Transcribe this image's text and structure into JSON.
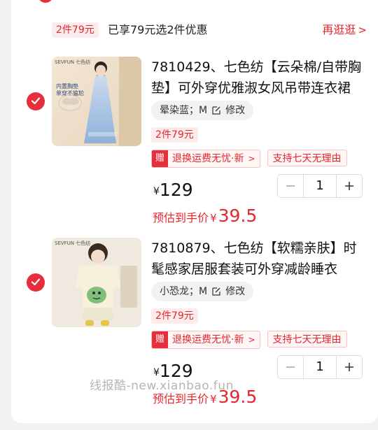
{
  "promo": {
    "tag": "2件79元",
    "text": "已享79元选2件优惠",
    "more": "再逛逛"
  },
  "items": [
    {
      "brand": "SEVFUN 七色纺",
      "thumb_caption": "内置胸垫\n单穿不尴尬",
      "title": "7810429、七色纺【云朵棉/自带胸垫】可外穿优雅淑女风吊带连衣裙",
      "spec": "晕染蓝；M",
      "edit": "修改",
      "deal": "2件79元",
      "gift_mark": "赠",
      "gift_text": "退换运费无忧·新",
      "badge2": "支持七天无理由",
      "currency": "¥",
      "price": "129",
      "quantity": "1",
      "est_label": "预估到手价",
      "est_price": "39.5"
    },
    {
      "brand": "SEVFUN 七色纺",
      "title": "7810879、七色纺【软糯亲肤】时髦感家居服套装可外穿减龄睡衣",
      "spec": "小恐龙；M",
      "edit": "修改",
      "deal": "2件79元",
      "gift_mark": "赠",
      "gift_text": "退换运费无忧·新",
      "badge2": "支持七天无理由",
      "currency": "¥",
      "price": "129",
      "quantity": "1",
      "est_label": "预估到手价",
      "est_price": "39.5"
    }
  ],
  "watermark": "线报酷-new.xianbao.fun",
  "colors": {
    "accent": "#e62e3c",
    "tag_bg": "#fdecec"
  }
}
